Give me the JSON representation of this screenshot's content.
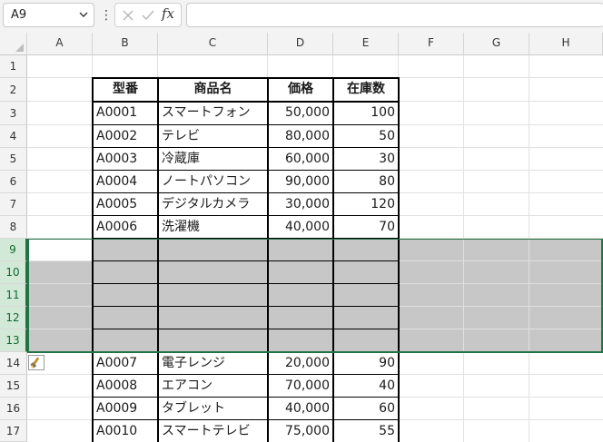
{
  "formula_bar": {
    "name_box": "A9",
    "formula": "",
    "fx_label": "fx"
  },
  "columns": [
    "A",
    "B",
    "C",
    "D",
    "E",
    "F",
    "G",
    "H"
  ],
  "rows": [
    "1",
    "2",
    "3",
    "4",
    "5",
    "6",
    "7",
    "8",
    "9",
    "10",
    "11",
    "12",
    "13",
    "14",
    "15",
    "16",
    "17"
  ],
  "table": {
    "headers": [
      "型番",
      "商品名",
      "価格",
      "在庫数"
    ],
    "upper_rows": [
      [
        "A0001",
        "スマートフォン",
        "50,000",
        "100"
      ],
      [
        "A0002",
        "テレビ",
        "80,000",
        "50"
      ],
      [
        "A0003",
        "冷蔵庫",
        "60,000",
        "30"
      ],
      [
        "A0004",
        "ノートパソコン",
        "90,000",
        "80"
      ],
      [
        "A0005",
        "デジタルカメラ",
        "30,000",
        "120"
      ],
      [
        "A0006",
        "洗濯機",
        "40,000",
        "70"
      ]
    ],
    "lower_rows": [
      [
        "A0007",
        "電子レンジ",
        "20,000",
        "90"
      ],
      [
        "A0008",
        "エアコン",
        "70,000",
        "40"
      ],
      [
        "A0009",
        "タブレット",
        "40,000",
        "60"
      ],
      [
        "A0010",
        "スマートテレビ",
        "75,000",
        "55"
      ]
    ]
  },
  "selection": {
    "active_cell": "A9",
    "rows": "9:13"
  },
  "colors": {
    "accent": "#217346",
    "selection_fill": "#c7c7c7",
    "header_bg": "#f3f3f3"
  },
  "icons": [
    "chevron-down-icon",
    "more-options-icon",
    "cancel-icon",
    "enter-icon",
    "fx-icon",
    "paste-options-icon",
    "select-all-icon"
  ]
}
